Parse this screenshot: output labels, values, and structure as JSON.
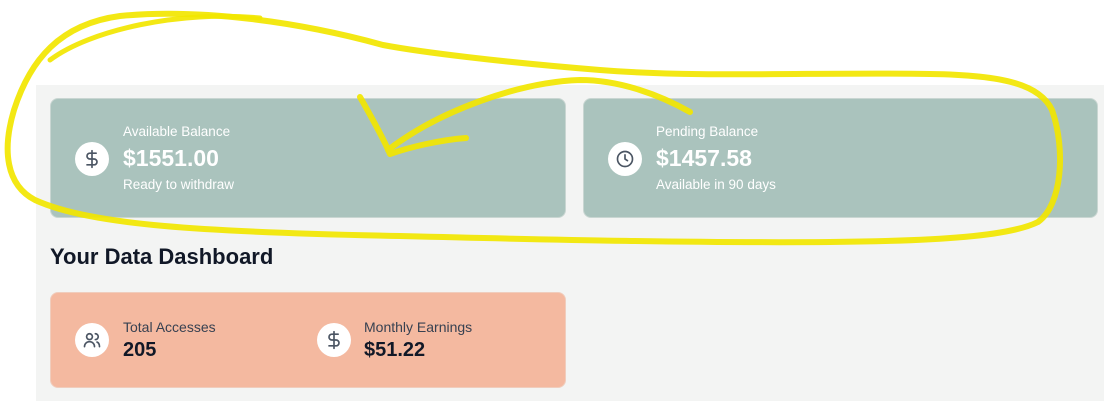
{
  "balances": {
    "available": {
      "label": "Available Balance",
      "amount": "$1551.00",
      "subtext": "Ready to withdraw",
      "icon": "dollar-icon"
    },
    "pending": {
      "label": "Pending Balance",
      "amount": "$1457.58",
      "subtext": "Available in 90 days",
      "icon": "clock-icon"
    }
  },
  "dashboard": {
    "title": "Your Data Dashboard",
    "stats": [
      {
        "label": "Total Accesses",
        "value": "205",
        "icon": "users-icon"
      },
      {
        "label": "Monthly Earnings",
        "value": "$51.22",
        "icon": "dollar-icon"
      }
    ]
  },
  "colors": {
    "balance_card": "#aac3bd",
    "stats_card": "#f4b9a0",
    "annotation_highlight": "#f2e600"
  }
}
